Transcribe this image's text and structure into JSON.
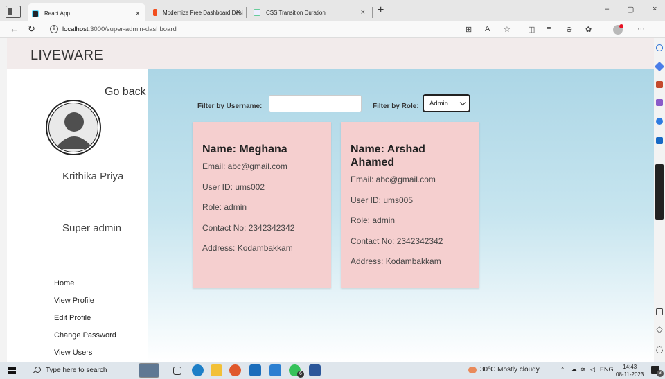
{
  "browser": {
    "tabs": [
      {
        "title": "React App",
        "active": true
      },
      {
        "title": "Modernize Free Dashboard Desi",
        "active": false
      },
      {
        "title": "CSS Transition Duration",
        "active": false
      }
    ],
    "tab_close_glyph": "×",
    "new_tab_glyph": "+",
    "window_controls": [
      "–",
      "▢",
      "×"
    ],
    "url_host": "localhost",
    "url_path": ":3000/super-admin-dashboard",
    "toolbar_icons": [
      "apps-icon",
      "read-aloud-icon",
      "favorite-icon",
      "split-screen-icon",
      "favorites-icon",
      "collections-icon",
      "extensions-icon",
      "profile-icon",
      "more-icon"
    ]
  },
  "app": {
    "logo": "LIVEWARE"
  },
  "sidebar": {
    "go_back": "Go back",
    "user_name": "Krithika Priya",
    "user_role": "Super admin",
    "nav": [
      "Home",
      "View Profile",
      "Edit Profile",
      "Change Password",
      "View Users"
    ]
  },
  "filters": {
    "username_label": "Filter by Username:",
    "username_value": "",
    "role_label": "Filter by Role:",
    "role_value": "Admin"
  },
  "users": [
    {
      "name": "Name: Meghana",
      "email": "Email: abc@gmail.com",
      "user_id": "User ID: ums002",
      "role": "Role: admin",
      "contact": "Contact No: 2342342342",
      "address": "Address: Kodambakkam"
    },
    {
      "name": "Name: Arshad Ahamed",
      "email": "Email: abc@gmail.com",
      "user_id": "User ID: ums005",
      "role": "Role: admin",
      "contact": "Contact No: 2342342342",
      "address": "Address: Kodambakkam"
    }
  ],
  "taskbar": {
    "search_placeholder": "Type here to search",
    "whatsapp_badge": "6",
    "weather": "30°C  Mostly cloudy",
    "language": "ENG",
    "time": "14:43",
    "date": "08-11-2023",
    "notification_count": "3"
  },
  "colors": {
    "header_bg": "#f2ebeb",
    "content_gradient_top": "#acd6e6",
    "card_bg": "#f5cfcf"
  }
}
